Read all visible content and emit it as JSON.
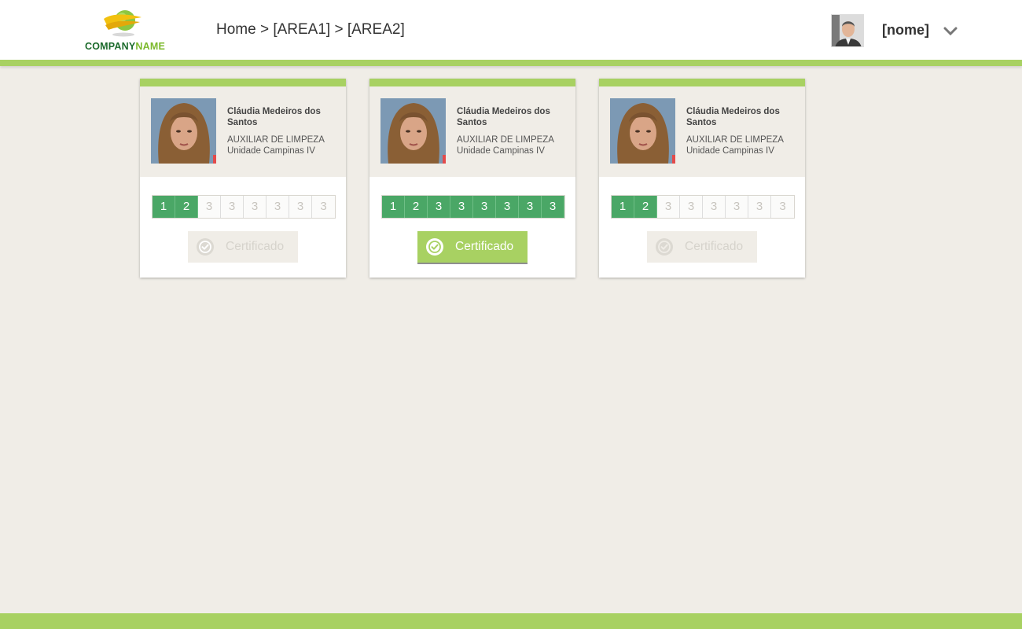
{
  "header": {
    "logo": {
      "text_part1": "COMPANY",
      "text_part2": "NAME"
    },
    "breadcrumb": "Home > [AREA1] > [AREA2]",
    "user": {
      "name": "[nome]"
    }
  },
  "colors": {
    "accent": "#a8d162",
    "step_done": "#4aa766",
    "background": "#f0ede7"
  },
  "cards": [
    {
      "name": "Cláudia Medeiros dos Santos",
      "role": "AUXILIAR DE LIMPEZA",
      "unit": "Unidade Campinas IV",
      "steps": [
        {
          "label": "1",
          "done": true
        },
        {
          "label": "2",
          "done": true
        },
        {
          "label": "3",
          "done": false
        },
        {
          "label": "3",
          "done": false
        },
        {
          "label": "3",
          "done": false
        },
        {
          "label": "3",
          "done": false
        },
        {
          "label": "3",
          "done": false
        },
        {
          "label": "3",
          "done": false
        }
      ],
      "certificate": {
        "label": "Certificado",
        "enabled": false
      }
    },
    {
      "name": "Cláudia Medeiros dos Santos",
      "role": "AUXILIAR DE LIMPEZA",
      "unit": "Unidade Campinas IV",
      "steps": [
        {
          "label": "1",
          "done": true
        },
        {
          "label": "2",
          "done": true
        },
        {
          "label": "3",
          "done": true
        },
        {
          "label": "3",
          "done": true
        },
        {
          "label": "3",
          "done": true
        },
        {
          "label": "3",
          "done": true
        },
        {
          "label": "3",
          "done": true
        },
        {
          "label": "3",
          "done": true
        }
      ],
      "certificate": {
        "label": "Certificado",
        "enabled": true
      }
    },
    {
      "name": "Cláudia Medeiros dos Santos",
      "role": "AUXILIAR DE LIMPEZA",
      "unit": "Unidade Campinas IV",
      "steps": [
        {
          "label": "1",
          "done": true
        },
        {
          "label": "2",
          "done": true
        },
        {
          "label": "3",
          "done": false
        },
        {
          "label": "3",
          "done": false
        },
        {
          "label": "3",
          "done": false
        },
        {
          "label": "3",
          "done": false
        },
        {
          "label": "3",
          "done": false
        },
        {
          "label": "3",
          "done": false
        }
      ],
      "certificate": {
        "label": "Certificado",
        "enabled": false
      }
    }
  ]
}
